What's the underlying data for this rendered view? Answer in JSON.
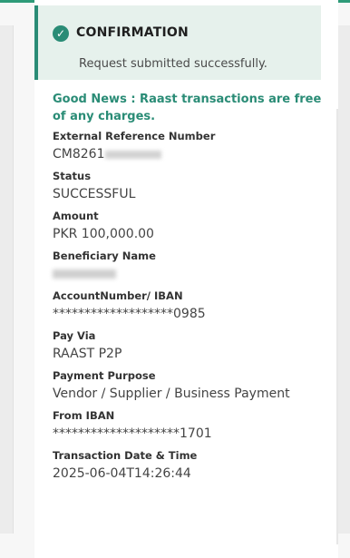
{
  "banner": {
    "title": "CONFIRMATION",
    "message": "Request submitted successfully."
  },
  "notice": "Good News : Raast transactions are free of any charges.",
  "fields": [
    {
      "label": "External Reference Number",
      "value_prefix": "CM8261"
    },
    {
      "label": "Status",
      "value": "SUCCESSFUL"
    },
    {
      "label": "Amount",
      "value": "PKR 100,000.00"
    },
    {
      "label": "Beneficiary Name"
    },
    {
      "label": "AccountNumber/ IBAN",
      "value": "*******************0985"
    },
    {
      "label": "Pay Via",
      "value": "RAAST P2P"
    },
    {
      "label": "Payment Purpose",
      "value": "Vendor / Supplier / Business Payment"
    },
    {
      "label": "From IBAN",
      "value": "********************1701"
    },
    {
      "label": "Transaction Date & Time",
      "value": "2025-06-04T14:26:44"
    }
  ],
  "colors": {
    "accent": "#2a8c76",
    "banner_bg": "#e6f1ec"
  }
}
